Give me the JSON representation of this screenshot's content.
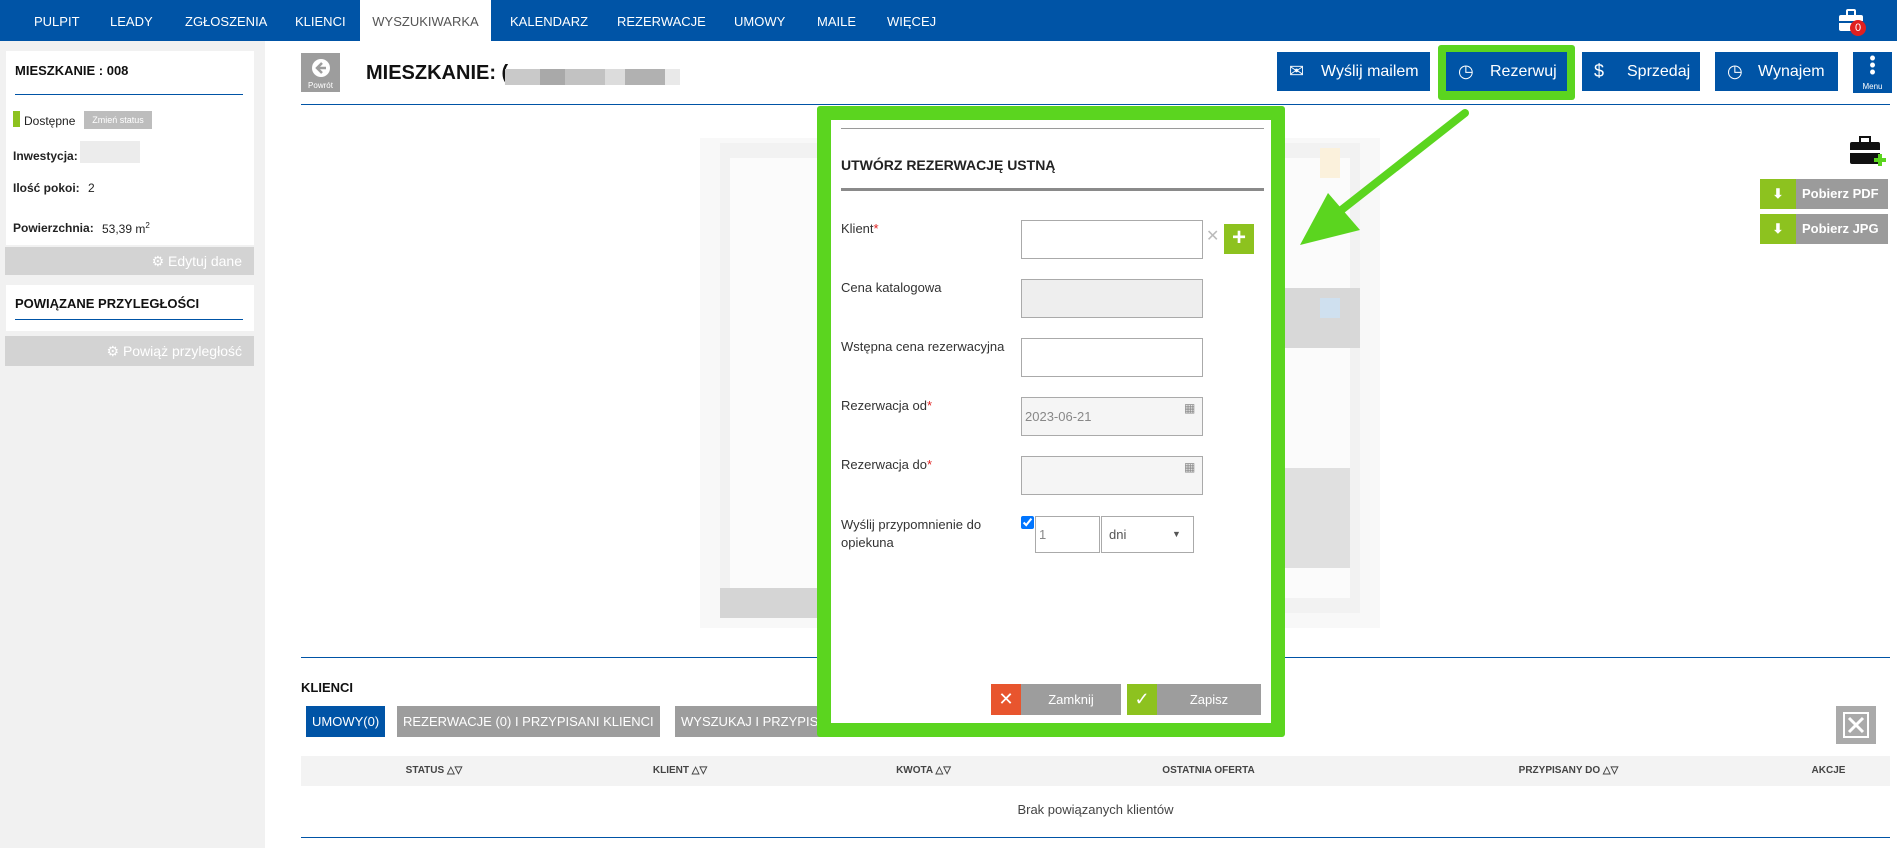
{
  "nav": {
    "items": [
      "PULPIT",
      "LEADY",
      "ZGŁOSZENIA",
      "KLIENCI",
      "WYSZUKIWARKA",
      "KALENDARZ",
      "REZERWACJE",
      "UMOWY",
      "MAILE",
      "WIĘCEJ"
    ],
    "active_index": 4,
    "cart_badge": "0"
  },
  "sidebar": {
    "title": "MIESZKANIE : 008",
    "status_label": "Dostępne",
    "change_status": "Zmień status",
    "investment_label": "Inwestycja:",
    "rooms_label": "Ilość pokoi:",
    "rooms_value": "2",
    "area_label": "Powierzchnia:",
    "area_value": "53,39 m",
    "area_sup": "2",
    "edit_button": "Edytuj dane",
    "related_title": "POWIĄZANE PRZYLEGŁOŚCI",
    "link_button": "Powiąż przyległość",
    "status_color": "#8dc21f"
  },
  "header": {
    "back_label": "Powrót",
    "title": "MIESZKANIE: (",
    "buttons": {
      "email": "Wyślij mailem",
      "reserve": "Rezerwuj",
      "sell": "Sprzedaj",
      "rent": "Wynajem",
      "menu": "Menu"
    }
  },
  "side_actions": {
    "pdf": "Pobierz PDF",
    "jpg": "Pobierz JPG"
  },
  "modal": {
    "title": "UTWÓRZ REZERWACJĘ USTNĄ",
    "client_label": "Klient",
    "catalog_price_label": "Cena katalogowa",
    "initial_price_label": "Wstępna cena rezerwacyjna",
    "from_label": "Rezerwacja od",
    "from_value": "2023-06-21",
    "to_label": "Rezerwacja do",
    "reminder_label": "Wyślij przypomnienie do opiekuna",
    "reminder_value": "1",
    "reminder_unit": "dni",
    "close_button": "Zamknij",
    "save_button": "Zapisz",
    "highlight_color": "#5bd51f"
  },
  "clients": {
    "title": "KLIENCI",
    "tabs": [
      "UMOWY(0)",
      "REZERWACJE (0) I PRZYPISANI KLIENCI",
      "WYSZUKAJ I PRZYPIS"
    ],
    "columns": [
      "STATUS",
      "KLIENT",
      "KWOTA",
      "OSTATNIA OFERTA",
      "PRZYPISANY DO",
      "AKCJE"
    ],
    "empty": "Brak powiązanych klientów"
  }
}
